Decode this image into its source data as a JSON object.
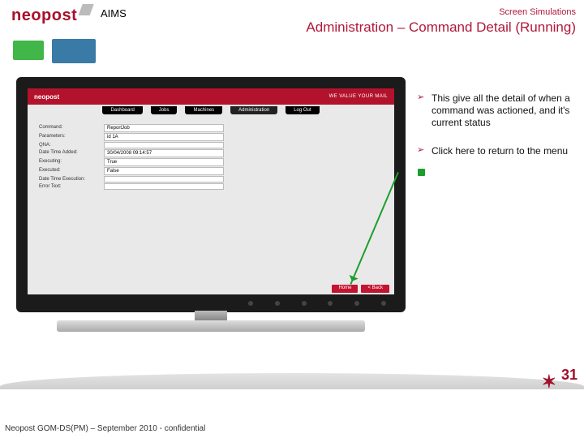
{
  "header": {
    "brand": "neopost",
    "product": "AIMS",
    "title_small": "Screen Simulations",
    "title_main": "Administration – Command Detail (Running)"
  },
  "screen": {
    "app_logo": "neopost",
    "tagline": "WE VALUE YOUR MAIL",
    "tabs": [
      "Dashboard",
      "Jobs",
      "Machines",
      "Administration",
      "Log Out"
    ],
    "rows": [
      {
        "label": "Command:",
        "value": "ReportJob"
      },
      {
        "label": "Parameters:",
        "value": "id 1A"
      },
      {
        "label": "QNA:",
        "value": ""
      },
      {
        "label": "Date Time Added:",
        "value": "30/04/2008 09:14:57"
      },
      {
        "label": "Executing:",
        "value": "True"
      },
      {
        "label": "Executed:",
        "value": "False"
      },
      {
        "label": "Date Time Execution:",
        "value": ""
      },
      {
        "label": "Error Text:",
        "value": ""
      }
    ],
    "buttons": {
      "home": "Home",
      "back": "< Back"
    }
  },
  "bullets": [
    "This give all the detail of when a command was actioned, and it's current status",
    "Click here to return to the menu"
  ],
  "footer": {
    "text": "Neopost GOM-DS(PM) – September 2010 - confidential",
    "page": "31"
  }
}
